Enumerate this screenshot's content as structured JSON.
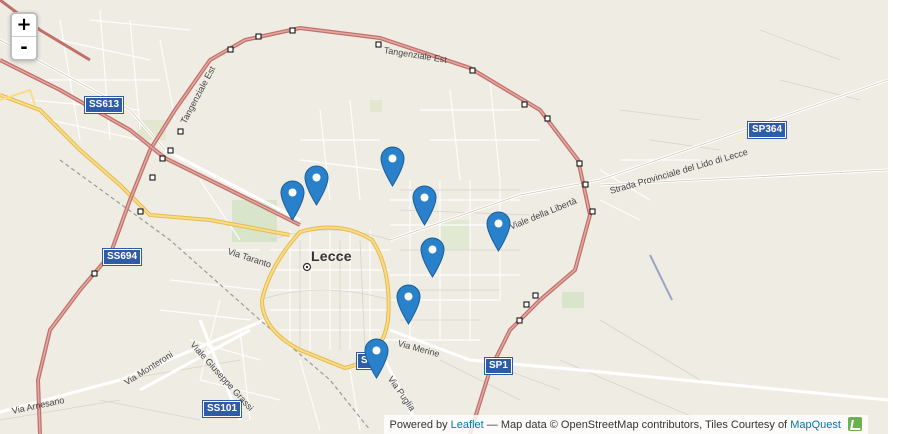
{
  "zoom": {
    "in_label": "+",
    "out_label": "-"
  },
  "city_label": "Lecce",
  "road_shields": [
    {
      "id": "ss613",
      "text": "SS613"
    },
    {
      "id": "ss694",
      "text": "SS694"
    },
    {
      "id": "ss101",
      "text": "SS101"
    },
    {
      "id": "sp364",
      "text": "SP364"
    },
    {
      "id": "sp1",
      "text": "SP1"
    },
    {
      "id": "ss16",
      "text": "SS"
    }
  ],
  "road_labels": {
    "tangenziale_est_1": "Tangenziale Est",
    "tangenziale_est_2": "Tangenziale Est",
    "tangenziale_est_3": "Tangenziale Est",
    "viale_liberta": "Viale della Libertà",
    "strada_provinciale": "Strada Provinciale del Lido di Lecce",
    "via_taranto": "Via Taranto",
    "via_merine": "Via Merine",
    "via_puglia": "Via Puglia",
    "via_monteroni": "Via Monteroni",
    "viale_grassi": "Viale Giuseppe Grassi",
    "via_arnesano": "Via Arnesano"
  },
  "markers": [
    {
      "id": "m1",
      "name": "marker-1"
    },
    {
      "id": "m2",
      "name": "marker-2"
    },
    {
      "id": "m3",
      "name": "marker-3"
    },
    {
      "id": "m4",
      "name": "marker-4"
    },
    {
      "id": "m5",
      "name": "marker-5"
    },
    {
      "id": "m6",
      "name": "marker-6"
    },
    {
      "id": "m7",
      "name": "marker-7"
    },
    {
      "id": "m8",
      "name": "marker-8"
    }
  ],
  "attribution": {
    "prefix": "Powered by",
    "leaflet": "Leaflet",
    "middle": "— Map data © OpenStreetMap contributors, Tiles Courtesy of",
    "mapquest": "MapQuest"
  },
  "colors": {
    "land": "#efece4",
    "ring_road": "#c0706a",
    "city_ring": "#f2c14e",
    "marker": "#2a81cb",
    "shield": "#2f5ca8"
  }
}
